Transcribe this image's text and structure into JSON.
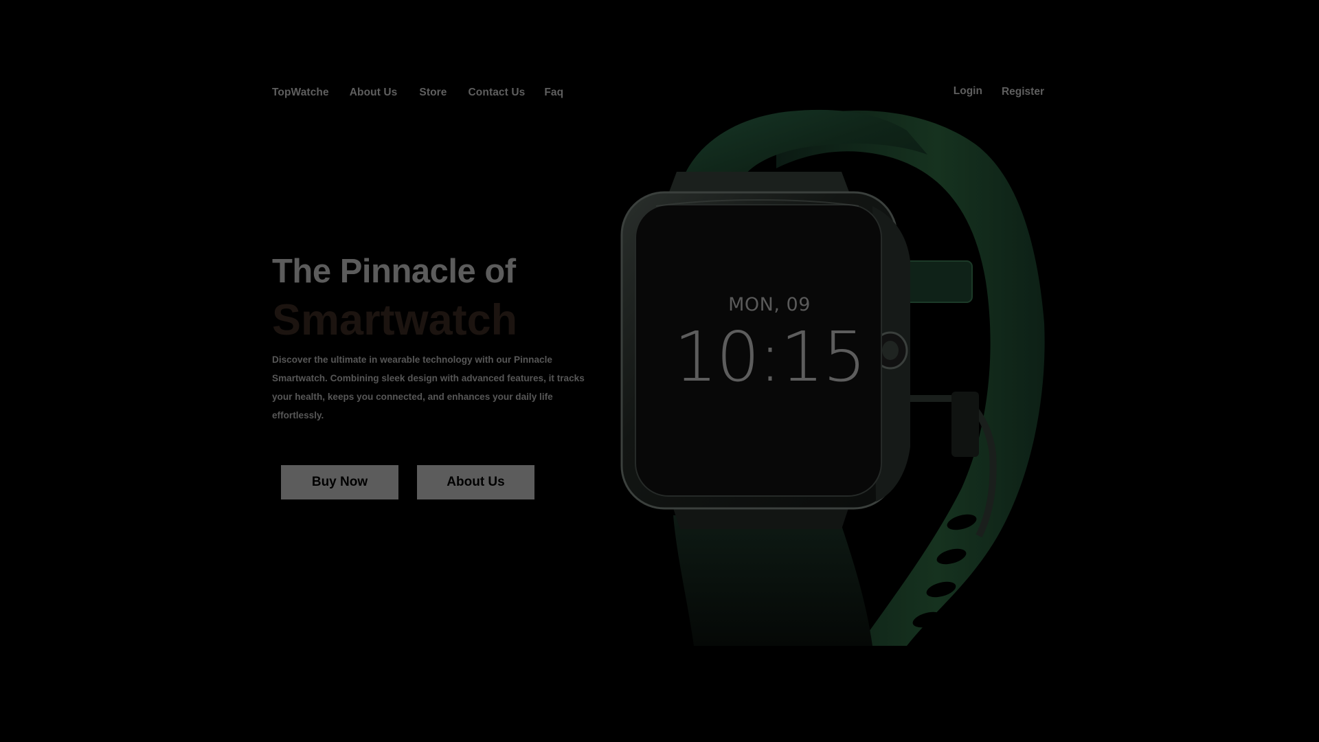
{
  "nav": {
    "brand": "TopWatche",
    "links": [
      "About Us",
      "Store",
      "Contact Us",
      "Faq"
    ],
    "login": "Login",
    "register": "Register"
  },
  "hero": {
    "title_line1": "The Pinnacle of",
    "title_line2": "Smartwatch",
    "description": "Discover the ultimate in wearable technology with our Pinnacle Smartwatch. Combining sleek design with advanced features,  it tracks your health, keeps you connected, and enhances your daily life effortlessly.",
    "buy_button": "Buy Now",
    "about_button": "About  Us"
  },
  "watch": {
    "date": "MON, 09",
    "time": "10:15"
  },
  "colors": {
    "background": "#000000",
    "text_muted": "#5f5f5f",
    "title_accent": "#1c1410",
    "button_bg": "#5c5c5c",
    "strap": "#0f2418"
  }
}
